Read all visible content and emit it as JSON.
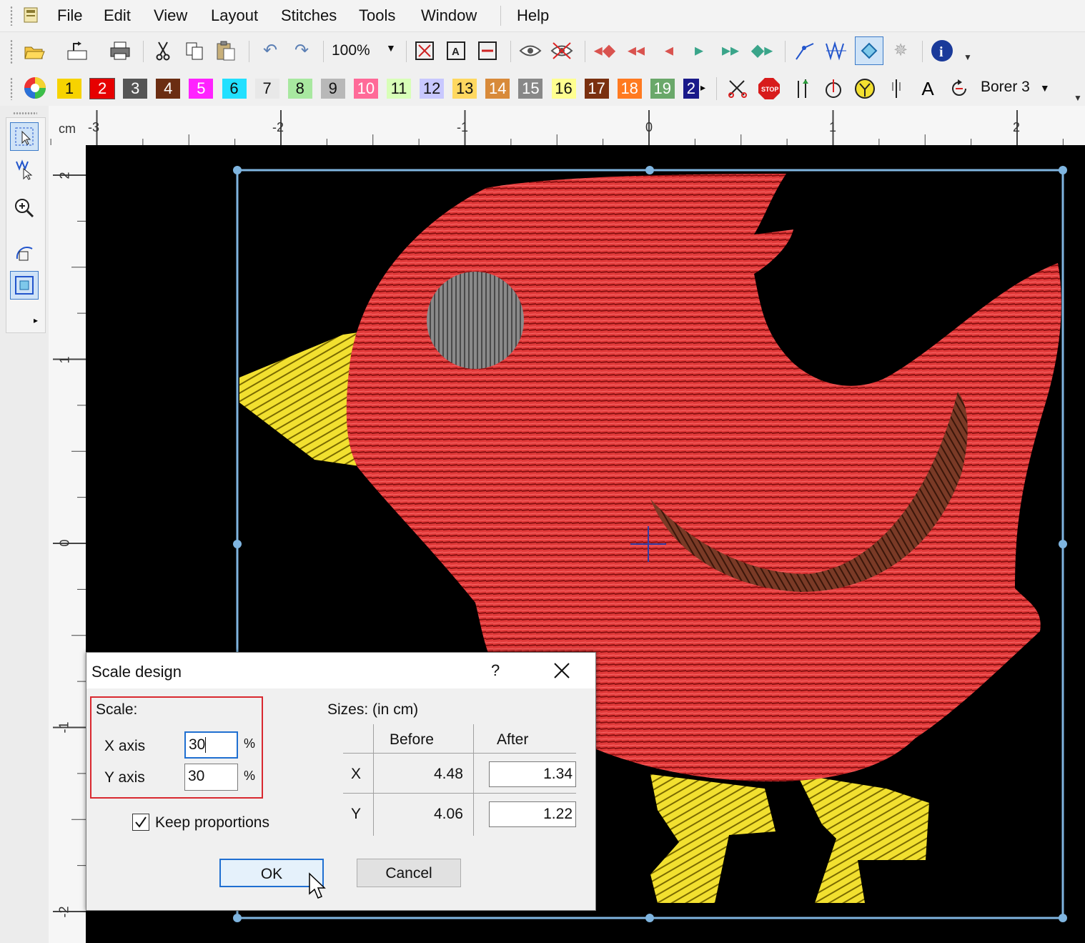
{
  "menu": {
    "items": [
      "File",
      "Edit",
      "View",
      "Layout",
      "Stitches",
      "Tools",
      "Window",
      "Help"
    ]
  },
  "toolbar": {
    "zoom_value": "100%",
    "icons": [
      "open-folder-icon",
      "export-icon",
      "print-icon",
      "cut-icon",
      "copy-icon",
      "paste-icon",
      "undo-icon",
      "redo-icon",
      "zoom-fit-icon",
      "zoom-selection-icon",
      "zoom-width-icon",
      "preview-eye-icon",
      "hide-eye-icon",
      "first-color-icon",
      "prev-color-icon",
      "prev-stitch-icon",
      "next-stitch-icon",
      "next-color-icon",
      "last-color-icon",
      "draw-line-icon",
      "stitch-density-icon",
      "select-tool-icon",
      "settings-icon",
      "info-icon"
    ]
  },
  "colorbar": {
    "swatches": [
      {
        "label": "1",
        "color": "#f7d300"
      },
      {
        "label": "2",
        "color": "#e60000"
      },
      {
        "label": "3",
        "color": "#555555"
      },
      {
        "label": "4",
        "color": "#6b2d12"
      },
      {
        "label": "5",
        "color": "#ff22ff"
      },
      {
        "label": "6",
        "color": "#22e0ff"
      },
      {
        "label": "7",
        "color": "#e8e8e8"
      },
      {
        "label": "8",
        "color": "#a8e8a0"
      },
      {
        "label": "9",
        "color": "#b8b8b8"
      },
      {
        "label": "10",
        "color": "#ff6a98"
      },
      {
        "label": "11",
        "color": "#d8ffb8"
      },
      {
        "label": "12",
        "color": "#c8c8ff"
      },
      {
        "label": "13",
        "color": "#ffd860"
      },
      {
        "label": "14",
        "color": "#d88a3a"
      },
      {
        "label": "15",
        "color": "#888888"
      },
      {
        "label": "16",
        "color": "#ffff90"
      },
      {
        "label": "17",
        "color": "#7a3010"
      },
      {
        "label": "18",
        "color": "#ff7a20"
      },
      {
        "label": "19",
        "color": "#6aa86a"
      },
      {
        "label": "2",
        "color": "#1a1a8a"
      }
    ],
    "tools": [
      "trim-icon",
      "stop-icon",
      "jump-icon",
      "needle-down-icon",
      "tie-icon",
      "needle-icon",
      "text-icon",
      "rotate-icon"
    ],
    "borer_label": "Borer 3"
  },
  "ruler": {
    "unit": "cm",
    "top_labels": [
      "-3",
      "-2",
      "-1",
      "0",
      "1",
      "2"
    ],
    "left_labels": [
      "2",
      "1",
      "0",
      "-1",
      "-2"
    ]
  },
  "dialog": {
    "title": "Scale design",
    "help": "?",
    "scale_label": "Scale:",
    "x_axis_label": "X axis",
    "y_axis_label": "Y axis",
    "x_value": "30",
    "y_value": "30",
    "percent": "%",
    "sizes_label": "Sizes: (in cm)",
    "col_before": "Before",
    "col_after": "After",
    "row_x": "X",
    "row_y": "Y",
    "x_before": "4.48",
    "x_after": "1.34",
    "y_before": "4.06",
    "y_after": "1.22",
    "keep_proportions": "Keep proportions",
    "keep_checked": true,
    "ok_label": "OK",
    "cancel_label": "Cancel"
  },
  "colors": {
    "selection_frame": "#7fb5e0",
    "bird_body": "#e23a3a",
    "beak_feet": "#f2e030",
    "wing": "#7a3a26",
    "eye": "#8a8a8a",
    "highlight_box": "#d9282f"
  }
}
